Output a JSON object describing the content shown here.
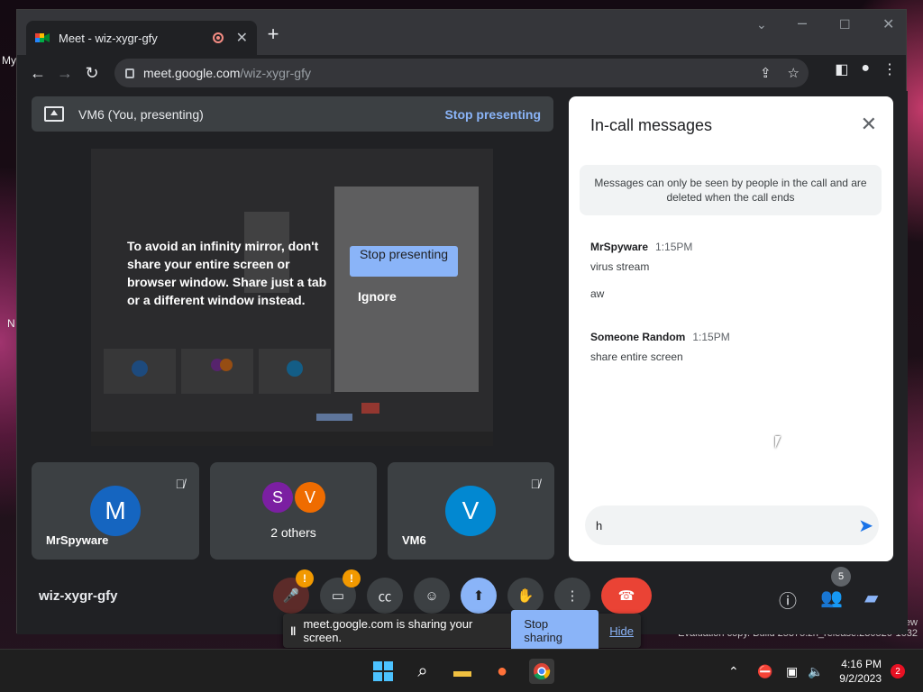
{
  "browser": {
    "tab_title": "Meet - wiz-xygr-gfy",
    "tab_close": "✕",
    "new_tab": "+",
    "url_host": "meet.google.com",
    "url_path": "/wiz-xygr-gfy"
  },
  "desktop": {
    "left_label_1": "My",
    "left_label_2": "N",
    "watermark_line": "Evaluation copy. Build 25375.zn_release.230520-1632",
    "watermark_right": "ew"
  },
  "presenting": {
    "title": "VM6 (You, presenting)",
    "stop": "Stop presenting"
  },
  "overlay": {
    "warning": "To avoid an infinity mirror, don't share your entire screen or browser window. Share just a tab or a different window instead.",
    "stop_button": "Stop presenting",
    "ignore_button": "Ignore"
  },
  "tiles": [
    {
      "name": "MrSpyware",
      "initial": "M",
      "color": "#1565c0"
    },
    {
      "name": "2 others",
      "initials": [
        "S",
        "V"
      ],
      "colors": [
        "#7b1fa2",
        "#ef6c00"
      ]
    },
    {
      "name": "VM6",
      "initial": "V",
      "color": "#0288d1"
    }
  ],
  "meeting_code": "wiz-xygr-gfy",
  "controls": {
    "mic_badge": "!",
    "cam_badge": "!",
    "people_count": "5"
  },
  "share_bar": {
    "text": "meet.google.com is sharing your screen.",
    "stop": "Stop sharing",
    "hide": "Hide"
  },
  "chat": {
    "title": "In-call messages",
    "note": "Messages can only be seen by people in the call and are deleted when the call ends",
    "messages": [
      {
        "sender": "MrSpyware",
        "time": "1:15PM",
        "lines": [
          "virus stream",
          "aw"
        ]
      },
      {
        "sender": "Someone Random",
        "time": "1:15PM",
        "lines": [
          "share entire screen"
        ]
      }
    ],
    "input_value": "h"
  },
  "taskbar": {
    "time": "4:16 PM",
    "date": "9/2/2023",
    "notifications": "2"
  }
}
